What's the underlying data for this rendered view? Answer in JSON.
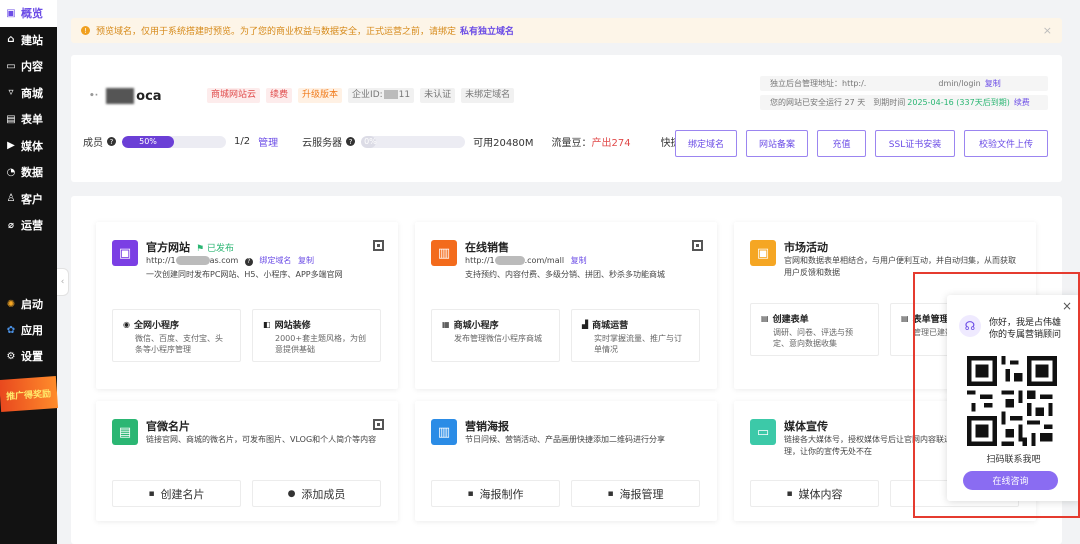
{
  "sidebar": {
    "items": [
      {
        "label": "概览",
        "icon": "gift-icon"
      },
      {
        "label": "建站",
        "icon": "home-icon"
      },
      {
        "label": "内容",
        "icon": "folder-icon"
      },
      {
        "label": "商城",
        "icon": "cart-icon"
      },
      {
        "label": "表单",
        "icon": "form-icon"
      },
      {
        "label": "媒体",
        "icon": "media-icon"
      },
      {
        "label": "数据",
        "icon": "chart-icon"
      },
      {
        "label": "客户",
        "icon": "user-icon"
      },
      {
        "label": "运营",
        "icon": "tag-icon"
      }
    ],
    "lower": [
      {
        "label": "启动",
        "icon": "launch-icon"
      },
      {
        "label": "应用",
        "icon": "apps-icon"
      },
      {
        "label": "设置",
        "icon": "gear-icon"
      }
    ],
    "promo": "推广得奖励",
    "accent": "#6b4ce6"
  },
  "notice": {
    "text": "预览域名，仅用于系统搭建时预览。为了您的商业权益与数据安全，正式运营之前，请绑定",
    "link": "私有独立域名"
  },
  "site": {
    "name_suffix": "oca",
    "tags": [
      "商城网站云",
      "续费",
      "升级版本",
      "企业ID:",
      "未认证",
      "未绑定域名"
    ],
    "company_id_suffix": "11",
    "admin_label": "独立后台管理地址：http:/.",
    "admin_path": "dmin/login",
    "admin_copy": "复制",
    "run_text": "您的网站已安全运行 27 天",
    "expire_label": "到期时间",
    "expire_date": "2025-04-16 (337天后到期)",
    "renew": "续费",
    "member_label": "成员",
    "member_progress": "50%",
    "member_count": "1/2",
    "member_manage": "管理",
    "server_label": "云服务器",
    "server_progress": "0%",
    "server_available": "可用20480M",
    "traffic_label": "流量豆：",
    "traffic_value": "产出274",
    "quick_label": "快捷",
    "actions": [
      "绑定域名",
      "网站备案",
      "充值",
      "SSL证书安装",
      "校验文件上传"
    ]
  },
  "cards": {
    "website": {
      "title": "官方网站",
      "status": "已发布",
      "url_prefix": "http://1",
      "url_suffix": "as.com",
      "bind": "绑定域名",
      "copy": "复制",
      "desc": "一次创建同时发布PC网站、H5、小程序、APP多端官网",
      "sub1_title": "全网小程序",
      "sub1_desc": "微信、百度、支付宝、头条等小程序管理",
      "sub2_title": "网站装修",
      "sub2_desc": "2000+套主题风格，为创意提供基础"
    },
    "shop": {
      "title": "在线销售",
      "url_prefix": "http://1",
      "url_suffix": ".com/mall",
      "copy": "复制",
      "desc": "支持预约、内容付费、多级分销、拼团、秒杀多功能商城",
      "sub1_title": "商城小程序",
      "sub1_desc": "发布管理微信小程序商城",
      "sub2_title": "商城运营",
      "sub2_desc": "实时掌握流量、推广与订单情况"
    },
    "market": {
      "title": "市场活动",
      "desc": "官网和数据表单相结合，与用户便利互动，并自动归集，从而获取用户反馈和数据",
      "sub1_title": "创建表单",
      "sub1_desc": "调研、问卷、评选与预定、意向数据收集",
      "sub2_title": "表单管理",
      "sub2_desc": "管理已建数据"
    },
    "namecard": {
      "title": "官微名片",
      "desc": "链接官网、商城的微名片，可发布图片、VLOG和个人简介等内容",
      "btn1": "创建名片",
      "btn2": "添加成员"
    },
    "poster": {
      "title": "营销海报",
      "desc": "节日问候、营销活动、产品画册快捷添加二维码进行分享",
      "btn1": "海报制作",
      "btn2": "海报管理"
    },
    "media": {
      "title": "媒体宣传",
      "desc": "链接各大媒体号，授权媒体号后让官网内容联通现引流、推广和管理，让你的宣传无处不在",
      "btn1": "媒体内容",
      "btn2": ""
    }
  },
  "popup": {
    "greeting": "你好，我是占伟雄",
    "role": "你的专属营销顾问",
    "scan": "扫码联系我吧",
    "consult": "在线咨询"
  }
}
